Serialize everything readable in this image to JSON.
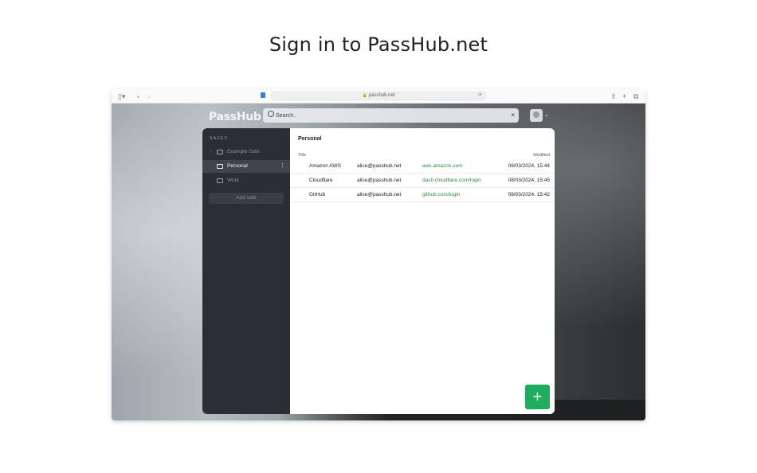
{
  "headline": "Sign in to PassHub.net",
  "browser": {
    "url": "passhub.net"
  },
  "app": {
    "logo": "PassHub",
    "search_placeholder": "Search..",
    "search_clear": "×"
  },
  "sidebar": {
    "heading": "SAFES",
    "safes": [
      {
        "label": "Example Safe",
        "expandable": true,
        "active": false
      },
      {
        "label": "Personal",
        "expandable": false,
        "active": true
      },
      {
        "label": "Work",
        "expandable": false,
        "active": false
      }
    ],
    "add_safe_label": "Add safe"
  },
  "main": {
    "title": "Personal",
    "columns": {
      "title": "Title",
      "modified": "Modified"
    },
    "rows": [
      {
        "title": "Amazon AWS",
        "username": "alice@passhub.net",
        "url": "aws.amazon.com",
        "modified": "08/03/2024, 15:44"
      },
      {
        "title": "Cloudflare",
        "username": "alice@passhub.net",
        "url": "dash.cloudflare.com/login",
        "modified": "08/03/2024, 15:45"
      },
      {
        "title": "GitHub",
        "username": "alice@passhub.net",
        "url": "github.com/login",
        "modified": "08/03/2024, 15:42"
      }
    ],
    "fab_label": "+"
  },
  "colors": {
    "accent": "#1fac5f",
    "url_text": "#2e8b3e",
    "sidebar_bg": "#2c2d35"
  }
}
